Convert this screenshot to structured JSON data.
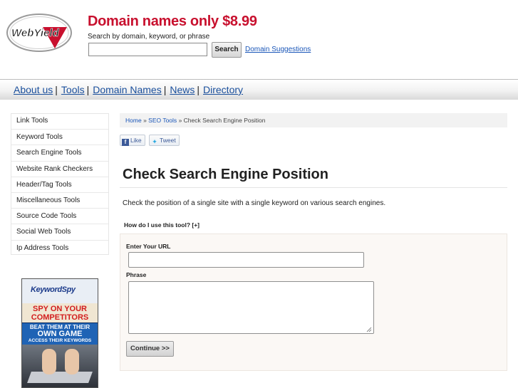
{
  "header": {
    "logo_text": "WebYield",
    "promo_title": "Domain names only $8.99",
    "search_hint": "Search by domain, keyword, or phrase",
    "search_value": "",
    "search_button": "Search",
    "suggestions_link": "Domain Suggestions",
    "brand_color": "#c8102e"
  },
  "nav": {
    "items": [
      {
        "label": "About us"
      },
      {
        "label": "Tools"
      },
      {
        "label": "Domain Names"
      },
      {
        "label": "News"
      },
      {
        "label": "Directory"
      }
    ],
    "separator": "|",
    "link_color": "#1a4f9c"
  },
  "sidebar": {
    "items": [
      {
        "label": "Link Tools"
      },
      {
        "label": "Keyword Tools"
      },
      {
        "label": "Search Engine Tools"
      },
      {
        "label": "Website Rank Checkers"
      },
      {
        "label": "Header/Tag Tools"
      },
      {
        "label": "Miscellaneous Tools"
      },
      {
        "label": "Source Code Tools"
      },
      {
        "label": "Social Web Tools"
      },
      {
        "label": "Ip Address Tools"
      }
    ]
  },
  "ad": {
    "logo": "KeywordSpy",
    "headline_1": "SPY ON YOUR",
    "headline_2": "COMPETITORS",
    "sub_1": "BEAT THEM AT THEIR",
    "sub_2": "OWN GAME",
    "sub_3": "ACCESS THEIR KEYWORDS"
  },
  "breadcrumb": {
    "home": "Home",
    "sep": "»",
    "section": "SEO Tools",
    "current": "Check Search Engine Position"
  },
  "social": {
    "like_label": "Like",
    "tweet_label": "Tweet"
  },
  "main": {
    "title": "Check Search Engine Position",
    "intro": "Check the position of a single site with a single keyword on various search engines.",
    "howto_label": "How do I use this tool? [+]"
  },
  "form": {
    "url_label": "Enter Your URL",
    "url_value": "",
    "phrase_label": "Phrase",
    "phrase_value": "",
    "continue_button": "Continue >>"
  }
}
